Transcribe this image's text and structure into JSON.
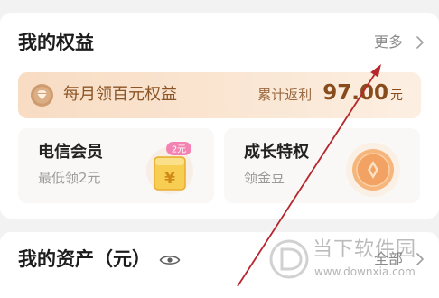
{
  "rights": {
    "title": "我的权益",
    "more": {
      "label": "更多",
      "icon": "chevron-right-icon"
    },
    "banner": {
      "icon": "gem-badge-icon",
      "label": "每月领百元权益",
      "rebate_label": "累计返利",
      "rebate_value": "97.00",
      "rebate_unit": "元"
    },
    "perks": [
      {
        "title": "电信会员",
        "subtitle": "最低领2元",
        "icon": "yuan-gift-box-icon",
        "icon_symbol": "¥",
        "badge": "2元"
      },
      {
        "title": "成长特权",
        "subtitle": "领金豆",
        "icon": "gold-coin-icon"
      }
    ]
  },
  "assets": {
    "title": "我的资产（元）",
    "visibility_icon": "eye-icon",
    "all": {
      "label": "全部",
      "icon": "chevron-right-icon"
    }
  },
  "watermark": {
    "logo_icon": "downxia-logo-icon",
    "name": "当下软件园",
    "url": "www.downxia.com"
  },
  "annotation": {
    "icon": "red-arrow-icon"
  },
  "colors": {
    "page_bg": "#f2f2f2",
    "card_bg": "#ffffff",
    "banner_text": "#8a5527",
    "rebate_value": "#874b1c",
    "badge_pink": "#f383b2",
    "coin_orange": "#f6b57b",
    "annotation_arrow": "#b5272d"
  }
}
